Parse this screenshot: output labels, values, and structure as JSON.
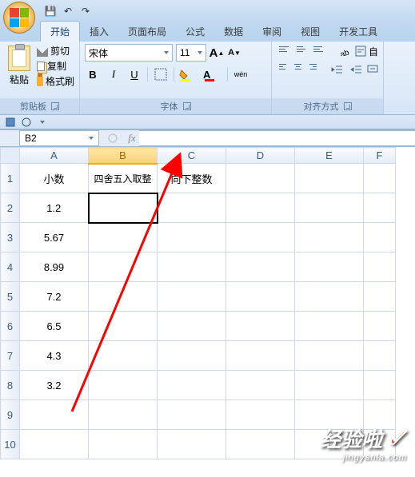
{
  "qat": {
    "save": "💾",
    "undo": "↶",
    "redo": "↷"
  },
  "tabs": {
    "home": "开始",
    "insert": "插入",
    "layout": "页面布局",
    "formula": "公式",
    "data": "数据",
    "review": "审阅",
    "view": "视图",
    "dev": "开发工具"
  },
  "ribbon": {
    "clipboard": {
      "title": "剪贴板",
      "paste": "粘贴",
      "cut": "剪切",
      "copy": "复制",
      "brush": "格式刷"
    },
    "font": {
      "title": "字体",
      "name": "宋体",
      "size": "11",
      "increaseA": "A",
      "decreaseA": "A",
      "bold": "B",
      "italic": "I",
      "underline": "U",
      "highlightA": "A",
      "colorA": "A",
      "pinyin": "wén"
    },
    "align": {
      "title": "对齐方式",
      "wrap": "自"
    }
  },
  "namebox": "B2",
  "fx": "fx",
  "columns": {
    "A": "A",
    "B": "B",
    "C": "C",
    "D": "D",
    "E": "E",
    "F": "F"
  },
  "rows": [
    "1",
    "2",
    "3",
    "4",
    "5",
    "6",
    "7",
    "8",
    "9",
    "10"
  ],
  "cells": {
    "A1": "小数",
    "B1": "四舍五入取整",
    "C1": "向下整数",
    "A2": "1.2",
    "A3": "5.67",
    "A4": "8.99",
    "A5": "7.2",
    "A6": "6.5",
    "A7": "4.3",
    "A8": "3.2"
  },
  "watermark": {
    "main": "经验啦",
    "check": "✓",
    "sub": "jingyanla.com"
  },
  "chart_data": {
    "type": "table",
    "columns": [
      "小数",
      "四舍五入取整",
      "向下整数"
    ],
    "rows": [
      [
        1.2,
        null,
        null
      ],
      [
        5.67,
        null,
        null
      ],
      [
        8.99,
        null,
        null
      ],
      [
        7.2,
        null,
        null
      ],
      [
        6.5,
        null,
        null
      ],
      [
        4.3,
        null,
        null
      ],
      [
        3.2,
        null,
        null
      ]
    ]
  }
}
